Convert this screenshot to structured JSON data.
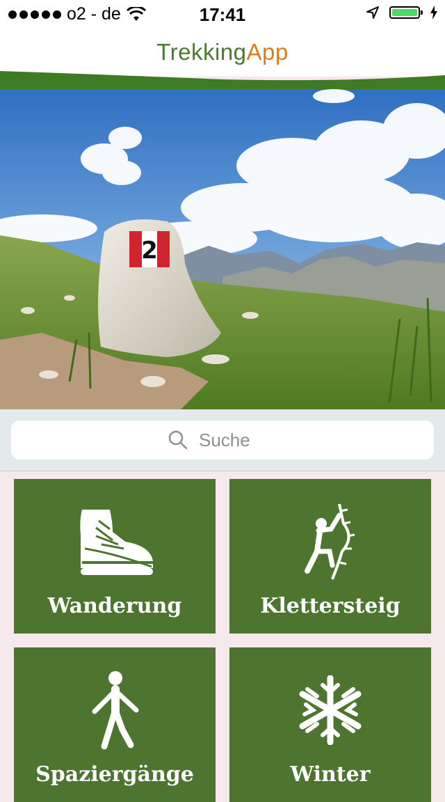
{
  "status_bar": {
    "carrier": "o2 - de",
    "time": "17:41"
  },
  "header": {
    "title_part1": "Trekking",
    "title_part2": "App"
  },
  "search": {
    "placeholder": "Suche"
  },
  "categories": [
    {
      "label": "Wanderung",
      "icon": "hiking-boot-icon"
    },
    {
      "label": "Klettersteig",
      "icon": "climber-icon"
    },
    {
      "label": "Spaziergänge",
      "icon": "walking-person-icon"
    },
    {
      "label": "Winter",
      "icon": "snowflake-icon"
    }
  ],
  "colors": {
    "tile_green": "#4d7530",
    "title_green": "#4c7a2e",
    "title_orange": "#e07c1d",
    "battery_green": "#4cd964"
  },
  "hero_marker_number": "2"
}
